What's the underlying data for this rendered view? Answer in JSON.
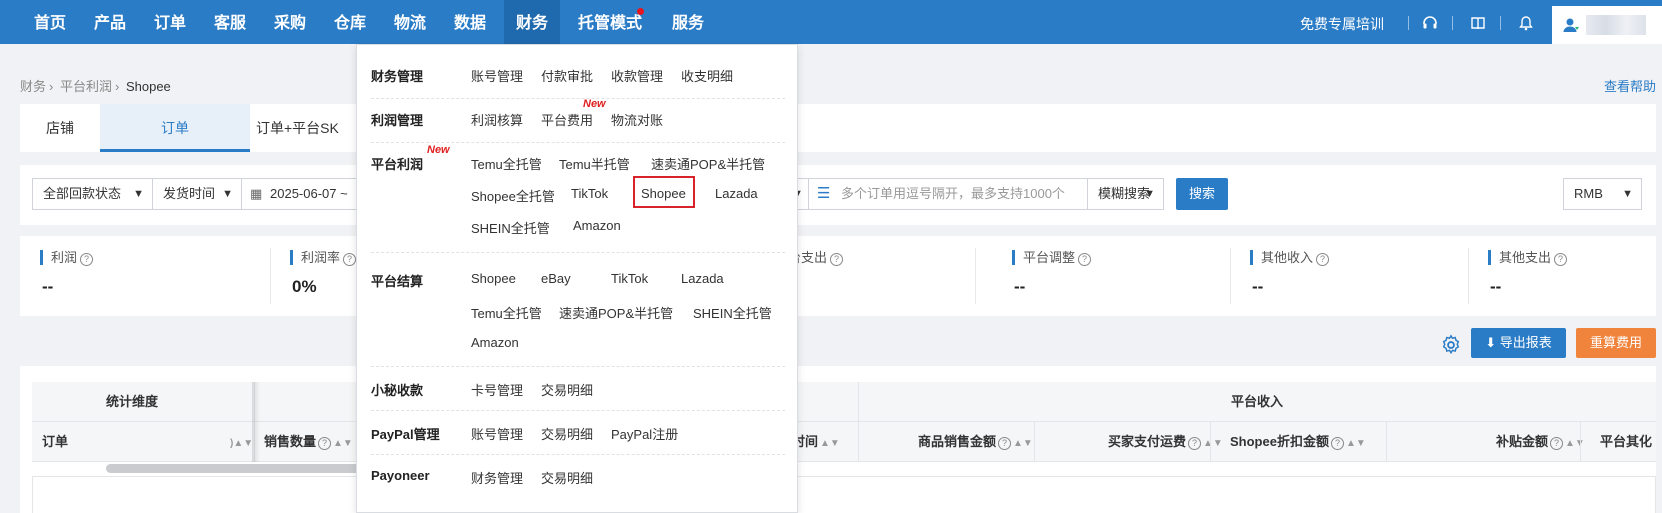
{
  "topnav": {
    "items": [
      "首页",
      "产品",
      "订单",
      "客服",
      "采购",
      "仓库",
      "物流",
      "数据",
      "财务",
      "托管模式",
      "服务"
    ],
    "active": "财务",
    "training": "免费专属培训",
    "icons": [
      "headset-icon",
      "book-icon",
      "bell-icon",
      "user-icon"
    ]
  },
  "breadcrumb": [
    "财务",
    "平台利润",
    "Shopee"
  ],
  "help": "查看帮助",
  "tabs": [
    "店铺",
    "订单",
    "订单+平台SK"
  ],
  "filters": {
    "payback": "全部回款状态",
    "timeType": "发货时间",
    "dateStart": "2025-06-07 ~",
    "searchPlaceholder": "多个订单用逗号隔开，最多支持1000个",
    "searchMode": "模糊搜索",
    "searchBtn": "搜索",
    "currency": "RMB"
  },
  "stats": [
    {
      "label": "利润",
      "value": "--"
    },
    {
      "label": "利润率",
      "value": "0%"
    },
    {
      "label": "台支出",
      "value": ""
    },
    {
      "label": "平台调整",
      "value": "--"
    },
    {
      "label": "其他收入",
      "value": "--"
    },
    {
      "label": "其他支出",
      "value": "--"
    }
  ],
  "actions": {
    "export": "导出报表",
    "recalc": "重算费用"
  },
  "table": {
    "group1": "统计维度",
    "group2": "平台收入",
    "cols": [
      "订单",
      "销售数量",
      "时间",
      "商品销售金额",
      "买家支付运费",
      "Shopee折扣金额",
      "补贴金额",
      "平台其化"
    ]
  },
  "menu": {
    "sections": [
      {
        "title": "财务管理",
        "links": [
          "账号管理",
          "付款审批",
          "收款管理",
          "收支明细"
        ]
      },
      {
        "title": "利润管理",
        "links": [
          "利润核算",
          "平台费用",
          "物流对账"
        ],
        "newOn": "平台费用"
      },
      {
        "title": "平台利润",
        "titleBadge": "New",
        "links": [
          "Temu全托管",
          "Temu半托管",
          "速卖通POP&半托管",
          "Shopee全托管",
          "TikTok",
          "Shopee",
          "Lazada",
          "SHEIN全托管",
          "Amazon"
        ],
        "selected": "Shopee"
      },
      {
        "title": "平台结算",
        "links": [
          "Shopee",
          "eBay",
          "TikTok",
          "Lazada",
          "Temu全托管",
          "速卖通POP&半托管",
          "SHEIN全托管",
          "Amazon"
        ]
      },
      {
        "title": "小秘收款",
        "links": [
          "卡号管理",
          "交易明细"
        ]
      },
      {
        "title": "PayPal管理",
        "links": [
          "账号管理",
          "交易明细",
          "PayPal注册"
        ]
      },
      {
        "title": "Payoneer",
        "links": [
          "财务管理",
          "交易明细"
        ]
      }
    ],
    "newBadge": "New"
  },
  "colors": {
    "nav": "#2b7cc6",
    "navActive": "#1f6aae",
    "accent": "#2b7cc6",
    "orange": "#f0843c",
    "highlight": "#d8232a"
  }
}
